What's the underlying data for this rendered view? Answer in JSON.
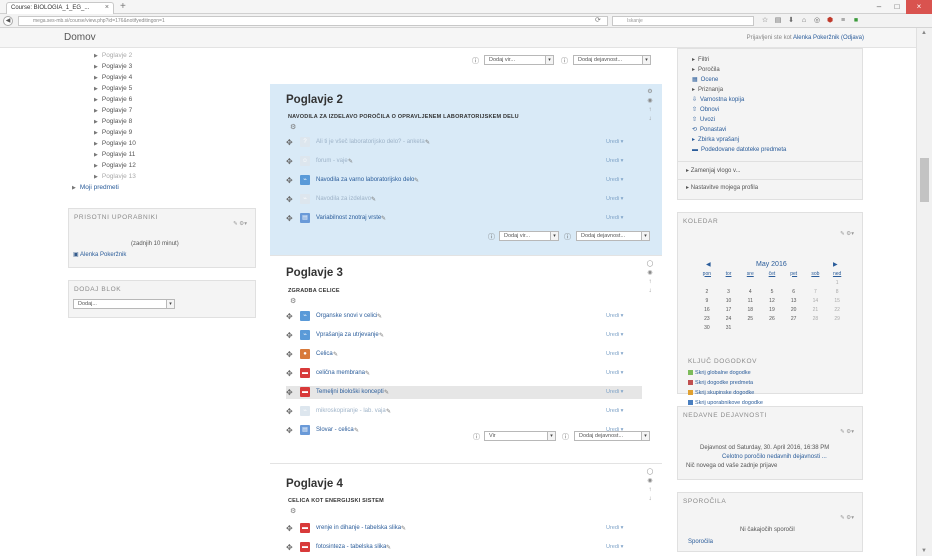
{
  "browser": {
    "tab_title": "Course: BIOLOGIA_1_EG_...",
    "tab_close": "×",
    "new_tab": "+",
    "url": "mega.ses-mb.si/course/view.php?id=176&notifyeditingon=1",
    "search_placeholder": "Iskanje",
    "win_min": "–",
    "win_max": "□",
    "win_close": "×"
  },
  "topnav": {
    "home": "Domov",
    "login_prefix": "Prijavljeni ste kot ",
    "user": "Alenka Pokeržnik",
    "logout": "(Odjava)"
  },
  "left": {
    "nav_items": [
      "Poglavje 2",
      "Poglavje 3",
      "Poglavje 4",
      "Poglavje 5",
      "Poglavje 6",
      "Poglavje 7",
      "Poglavje 8",
      "Poglavje 9",
      "Poglavje 10",
      "Poglavje 11",
      "Poglavje 12",
      "Poglavje 13"
    ],
    "moji_predmeti": "Moji predmeti",
    "online_title": "PRISOTNI UPORABNIKI",
    "online_period": "(zadnjih 10 minut)",
    "online_user": "Alenka Pokeržnik",
    "addblock_title": "DODAJ BLOK",
    "addblock_select": "Dodaj..."
  },
  "sections": {
    "top_controls": {
      "add_res": "Dodaj vir...",
      "add_act": "Dodaj dejavnost..."
    },
    "s2": {
      "title": "Poglavje 2",
      "summary": "NAVODILA ZA IZDELAVO POROČILA O OPRAVLJENEM LABORATORIJSKEM DELU",
      "activities": [
        {
          "label": "Ali ti je všeč laboratorijsko delo? - anketa",
          "dim": true
        },
        {
          "label": "forum - vaje",
          "dim": true
        },
        {
          "label": "Navodila za varno laboratorijsko delo",
          "dim": false
        },
        {
          "label": "Navodila za izdelavo",
          "dim": true
        },
        {
          "label": "Variabilnost znotraj vrste",
          "dim": false
        }
      ],
      "add_res": "Dodaj vir...",
      "add_act": "Dodaj dejavnost..."
    },
    "s3": {
      "title": "Poglavje 3",
      "summary": "ZGRADBA CELICE",
      "activities": [
        {
          "label": "Organske snovi v celici",
          "dim": false
        },
        {
          "label": "Vprašanja za utrjevanje",
          "dim": false
        },
        {
          "label": "Celica",
          "dim": false
        },
        {
          "label": "celična membrana",
          "dim": false
        },
        {
          "label": "Temeljni biološki koncepti",
          "dim": false
        },
        {
          "label": "mikroskopiranje - lab. vaja",
          "dim": true
        },
        {
          "label": "Slovar - celica",
          "dim": false
        }
      ],
      "add_res": "Vir",
      "add_act": "Dodaj dejavnost..."
    },
    "s4": {
      "title": "Poglavje 4",
      "summary": "CELICA KOT ENERGIJSKI SISTEM",
      "activities": [
        {
          "label": "vrenje in dihanje - tabelska slika",
          "dim": false
        },
        {
          "label": "fotosinteza - tabelska slika",
          "dim": false
        }
      ]
    },
    "edit_label": "Uredi"
  },
  "right": {
    "admin_items": [
      "Filtri",
      "Poročila",
      "Ocene",
      "Priznanja",
      "Varnostna kopija",
      "Obnovi",
      "Uvozi",
      "Ponastavi",
      "Zbirka vprašanj",
      "Podedovane datoteke predmeta"
    ],
    "switch_role": "Zamenjaj vlogo v...",
    "profile_settings": "Nastavitve mojega profila",
    "calendar_title": "KOLEDAR",
    "month": "May 2016",
    "days": [
      "pon",
      "tor",
      "sre",
      "čet",
      "pet",
      "sob",
      "ned"
    ],
    "weeks": [
      [
        "",
        "",
        "",
        "",
        "",
        "",
        "1"
      ],
      [
        "2",
        "3",
        "4",
        "5",
        "6",
        "7",
        "8"
      ],
      [
        "9",
        "10",
        "11",
        "12",
        "13",
        "14",
        "15"
      ],
      [
        "16",
        "17",
        "18",
        "19",
        "20",
        "21",
        "22"
      ],
      [
        "23",
        "24",
        "25",
        "26",
        "27",
        "28",
        "29"
      ],
      [
        "30",
        "31",
        "",
        "",
        "",
        "",
        ""
      ]
    ],
    "key_title": "KLJUČ DOGODKOV",
    "key_items": [
      {
        "label": "Skrij globalne dogodke",
        "color": "#7dbb5b"
      },
      {
        "label": "Skrij dogodke predmeta",
        "color": "#c05050"
      },
      {
        "label": "Skrij skupinske dogodke",
        "color": "#e0a030"
      },
      {
        "label": "Skrij uporabnikove dogodke",
        "color": "#4a7fc0"
      }
    ],
    "recent_title": "NEDAVNE DEJAVNOSTI",
    "recent_since": "Dejavnost od Saturday, 30. April 2016, 16:38 PM",
    "recent_link": "Celotno poročilo nedavnih dejavnosti ...",
    "recent_none": "Nič novega od vaše zadnje prijave",
    "messages_title": "SPOROČILA",
    "messages_none": "Ni čakajočih sporočil",
    "messages_link": "Sporočila"
  },
  "colors": {
    "section_highlight": "#d9eaf7",
    "link": "#2a5c9a"
  }
}
